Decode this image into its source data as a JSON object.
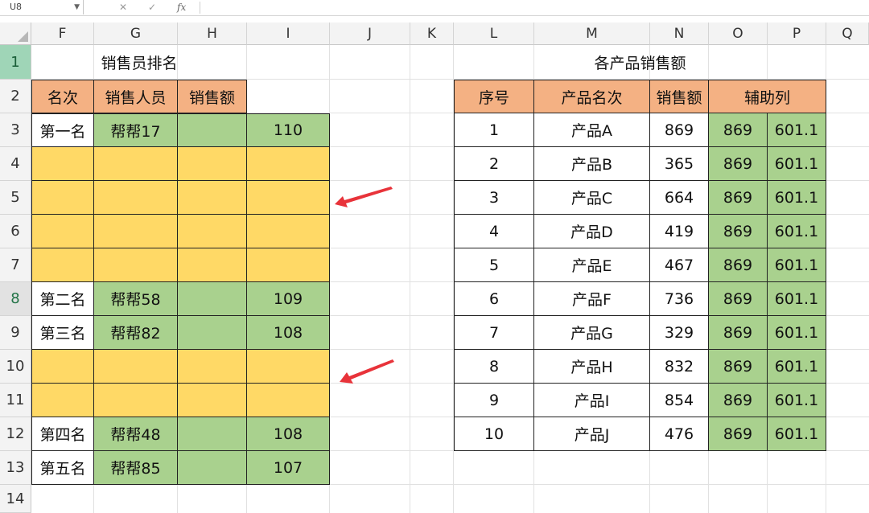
{
  "formula_bar": {
    "name_box": "U8",
    "cancel_icon": "cancel-icon",
    "enter_icon": "check-icon",
    "fx_label": "fx",
    "formula": ""
  },
  "columns": [
    "F",
    "G",
    "H",
    "I",
    "J",
    "K",
    "L",
    "M",
    "N",
    "O",
    "P",
    "Q"
  ],
  "rows": [
    "1",
    "2",
    "3",
    "4",
    "5",
    "6",
    "7",
    "8",
    "9",
    "10",
    "11",
    "12",
    "13",
    "14"
  ],
  "left_table": {
    "title": "销售员排名",
    "headers": [
      "名次",
      "销售人员",
      "销售额"
    ],
    "rows": [
      {
        "rank": "第一名",
        "person": "帮帮17",
        "sales": "",
        "value": "110",
        "kind": "data"
      },
      {
        "rank": "",
        "person": "",
        "sales": "",
        "value": "",
        "kind": "blank"
      },
      {
        "rank": "",
        "person": "",
        "sales": "",
        "value": "",
        "kind": "blank"
      },
      {
        "rank": "",
        "person": "",
        "sales": "",
        "value": "",
        "kind": "blank"
      },
      {
        "rank": "",
        "person": "",
        "sales": "",
        "value": "",
        "kind": "blank"
      },
      {
        "rank": "第二名",
        "person": "帮帮58",
        "sales": "",
        "value": "109",
        "kind": "data"
      },
      {
        "rank": "第三名",
        "person": "帮帮82",
        "sales": "",
        "value": "108",
        "kind": "data"
      },
      {
        "rank": "",
        "person": "",
        "sales": "",
        "value": "",
        "kind": "blank"
      },
      {
        "rank": "",
        "person": "",
        "sales": "",
        "value": "",
        "kind": "blank"
      },
      {
        "rank": "第四名",
        "person": "帮帮48",
        "sales": "",
        "value": "108",
        "kind": "data"
      },
      {
        "rank": "第五名",
        "person": "帮帮85",
        "sales": "",
        "value": "107",
        "kind": "data"
      }
    ]
  },
  "right_table": {
    "title": "各产品销售额",
    "headers": [
      "序号",
      "产品名次",
      "销售额",
      "辅助列"
    ],
    "rows": [
      {
        "no": "1",
        "product": "产品A",
        "sales": "869",
        "aux1": "869",
        "aux2": "601.1"
      },
      {
        "no": "2",
        "product": "产品B",
        "sales": "365",
        "aux1": "869",
        "aux2": "601.1"
      },
      {
        "no": "3",
        "product": "产品C",
        "sales": "664",
        "aux1": "869",
        "aux2": "601.1"
      },
      {
        "no": "4",
        "product": "产品D",
        "sales": "419",
        "aux1": "869",
        "aux2": "601.1"
      },
      {
        "no": "5",
        "product": "产品E",
        "sales": "467",
        "aux1": "869",
        "aux2": "601.1"
      },
      {
        "no": "6",
        "product": "产品F",
        "sales": "736",
        "aux1": "869",
        "aux2": "601.1"
      },
      {
        "no": "7",
        "product": "产品G",
        "sales": "329",
        "aux1": "869",
        "aux2": "601.1"
      },
      {
        "no": "8",
        "product": "产品H",
        "sales": "832",
        "aux1": "869",
        "aux2": "601.1"
      },
      {
        "no": "9",
        "product": "产品I",
        "sales": "854",
        "aux1": "869",
        "aux2": "601.1"
      },
      {
        "no": "10",
        "product": "产品J",
        "sales": "476",
        "aux1": "869",
        "aux2": "601.1"
      }
    ]
  },
  "colors": {
    "header_fill": "#f4b183",
    "green_fill": "#a9d18e",
    "yellow_fill": "#ffd966",
    "arrow": "#e8333a",
    "selected_row_header": "#9fd5b7"
  }
}
